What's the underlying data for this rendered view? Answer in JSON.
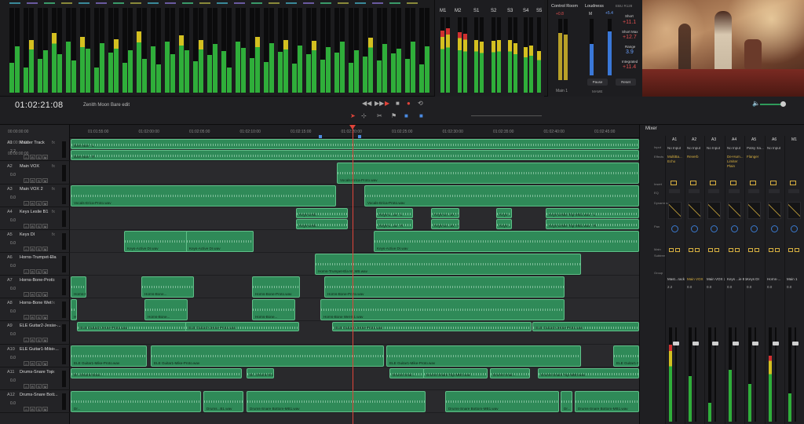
{
  "meter_bridge": {
    "right_labels": [
      "M1",
      "M2",
      "S1",
      "S2",
      "S3",
      "S4",
      "S5"
    ]
  },
  "control_room": {
    "title": "Control Room",
    "scale_top": "+0.8",
    "output": "Main 1"
  },
  "loudness": {
    "title": "Loudness",
    "standard": "EBU R128",
    "m_label": "M",
    "m_value": "+5.4",
    "short_label": "Short",
    "short_value": "+11.1",
    "short_max_label": "Short Max",
    "short_max_value": "+12.7",
    "range_label": "Range",
    "range_value": "3.9",
    "integrated_label": "Integrated",
    "integrated_value": "+11.4",
    "pause": "Pause",
    "reset": "Reset",
    "mode": "MAME"
  },
  "toolbar": {
    "timecode": "01:02:21:08",
    "timeline_name": "Zenith Moon Bare edit"
  },
  "header_rows": {
    "timecodes": [
      "00:00:00:00",
      "00:00:00:00",
      "00:00:00:00"
    ]
  },
  "ruler": {
    "ticks": [
      "01:01:55:00",
      "01:02:00:00",
      "01:02:05:00",
      "01:02:10:00",
      "01:02:15:00",
      "01:02:20:00",
      "01:02:25:00",
      "01:02:30:00",
      "01:02:35:00",
      "01:02:40:00",
      "01:02:45:00"
    ]
  },
  "tracks": [
    {
      "id": "A1",
      "name": "Master Track",
      "vol": "2.2"
    },
    {
      "id": "A2",
      "name": "Main VOX",
      "vol": "0.0"
    },
    {
      "id": "A3",
      "name": "Main VOX 2",
      "vol": "0.0"
    },
    {
      "id": "A4",
      "name": "Keys Leslie B1",
      "vol": "0.0"
    },
    {
      "id": "A5",
      "name": "Keys DI",
      "vol": "0.0"
    },
    {
      "id": "A6",
      "name": "Horns-Trumpet-Ela",
      "vol": "0.0"
    },
    {
      "id": "A7",
      "name": "Horns-Bone-Proto",
      "vol": "0.0"
    },
    {
      "id": "A8",
      "name": "Horns-Bone Wet",
      "vol": "0.0"
    },
    {
      "id": "A9",
      "name": "ELE Guitar2-Jesse-...",
      "vol": "0.0"
    },
    {
      "id": "A10",
      "name": "ELE Guitar1-Mike-...",
      "vol": "0.0"
    },
    {
      "id": "A11",
      "name": "Drums-Snare Top",
      "vol": "0.0"
    },
    {
      "id": "A12",
      "name": "Drums-Snare Bott...",
      "vol": "0.0"
    }
  ],
  "clips": {
    "a1_l": "Bare.wav - L",
    "a1_r": "Bare.wav - R",
    "a2": "Vocals-Erica-Proto.wav",
    "a3a": "Vocals-Erica-Proto.wav",
    "a3b": "Vocals-Erica-Proto.wav",
    "a4a": "Keys-Lesli...",
    "a4b": "Keys-L...av - L",
    "a4c": "Keys-Le...av - L",
    "a4d": "Keys-...L",
    "a4e": "Keys-Leslie Top-MB1.wav - L",
    "a4f": "Keys-Lesli...",
    "a4g": "Keys-L...av - R",
    "a4h": "Keys-Le...av - R",
    "a4i": "Keys-...R",
    "a4j": "Keys-Leslie Top-MB1.wav - R",
    "a5a": "Keys-Active DI.wav",
    "a5b": "Keys-Active DI.wav",
    "a5c": "Keys-Active DI.wav",
    "a6": "Horns-Trumpet-Ela M_MB.wav",
    "a7a": "Horns-Bone...",
    "a7b": "Horns-Bone...",
    "a7c": "Horns-Bone-Proto.wav",
    "a8a": "Horns-Bone...",
    "a8b": "Horns-Bone...",
    "a8c": "Horns-Bone Wet-B1.wav",
    "a9a": "ELE Guitar2-Jesse-Proto.wav",
    "a9b": "ELE Guitar2-Jesse-Proto.wav",
    "a9c": "ELE Guitar2-Jesse-Proto.wav",
    "a9d": "ELE Guitar2-Jesse-Proto.wav",
    "a10a": "ELE Guitar1-Mike-Proto.wav",
    "a10b": "ELE Guitar1-Mike-Proto.wav",
    "a11a": "Dr...Drums-Snar...",
    "a11b": "Drums-Snar...",
    "a11c": "Drums-Snare Top-MB0.wav",
    "a11d": "Drums-Snar...",
    "a11e": "Drums-Snare Top-MB0.wav",
    "a12a": "Dr...",
    "a12b": "Drums...B1.wav",
    "a12c": "Drums-Snare Bottom-MB1.wav",
    "a12d": "Drums-Snare Bottom-MB1.wav",
    "a12e": "Dr...",
    "a12f": "Drums-Snare Bottom-MB1.wav"
  },
  "mixer": {
    "title": "Mixer",
    "row_labels": [
      "Input",
      "Effects",
      "Insert",
      "EQ",
      "Dynamics",
      "Pan",
      "Main",
      "Subtree",
      "Group"
    ],
    "channels": [
      {
        "id": "A1",
        "input": "No Input",
        "effects": "MultiBa... Echo",
        "name": "Mast...rack",
        "vol": "2.2"
      },
      {
        "id": "A2",
        "input": "No Input",
        "effects": "Reverb",
        "name": "Main VOX",
        "vol": "0.0"
      },
      {
        "id": "A3",
        "input": "No Input",
        "effects": "",
        "name": "Main VOX 2",
        "vol": "0.0"
      },
      {
        "id": "A4",
        "input": "No Input",
        "effects": "De-Hum... Limiter Plain",
        "name": "Keys ...ie B1",
        "vol": "0.0"
      },
      {
        "id": "A5",
        "input": "Patsy Sa...",
        "effects": "Flanger",
        "name": "Keys DI",
        "vol": "0.0"
      },
      {
        "id": "A6",
        "input": "No Input",
        "effects": "",
        "name": "Horns-...",
        "vol": "0.0"
      },
      {
        "id": "M1",
        "input": "",
        "effects": "",
        "name": "Main 1",
        "vol": "0.0"
      }
    ]
  }
}
